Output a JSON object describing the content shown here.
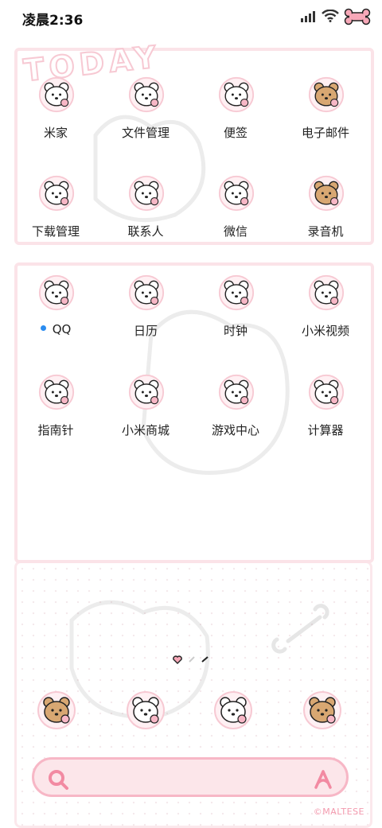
{
  "status_bar": {
    "time": "凌晨2:36",
    "icons": [
      "signal-icon",
      "wifi-icon",
      "bone-battery-icon"
    ]
  },
  "wallpaper": {
    "banner_text": "TODAY",
    "accent": "#f7b7c6",
    "frame": "#fbe3e8"
  },
  "apps": [
    {
      "label": "米家",
      "icon": "bear-mijia-icon",
      "badge": false
    },
    {
      "label": "文件管理",
      "icon": "bear-files-icon",
      "badge": false
    },
    {
      "label": "便签",
      "icon": "bear-notes-icon",
      "badge": false
    },
    {
      "label": "电子邮件",
      "icon": "bear-mail-icon",
      "badge": false
    },
    {
      "label": "下载管理",
      "icon": "bear-download-icon",
      "badge": false
    },
    {
      "label": "联系人",
      "icon": "bear-contacts-icon",
      "badge": false
    },
    {
      "label": "微信",
      "icon": "bear-wechat-icon",
      "badge": false
    },
    {
      "label": "录音机",
      "icon": "bear-recorder-icon",
      "badge": false
    },
    {
      "label": "QQ",
      "icon": "bear-qq-icon",
      "badge": true
    },
    {
      "label": "日历",
      "icon": "bear-calendar-icon",
      "badge": false
    },
    {
      "label": "时钟",
      "icon": "bear-clock-icon",
      "badge": false
    },
    {
      "label": "小米视频",
      "icon": "bear-video-icon",
      "badge": false
    },
    {
      "label": "指南针",
      "icon": "bear-compass-icon",
      "badge": false
    },
    {
      "label": "小米商城",
      "icon": "bear-mall-icon",
      "badge": false
    },
    {
      "label": "游戏中心",
      "icon": "bear-game-icon",
      "badge": false
    },
    {
      "label": "计算器",
      "icon": "bear-calculator-icon",
      "badge": false
    }
  ],
  "dock": [
    {
      "icon": "bear-phone-icon"
    },
    {
      "icon": "bear-messages-icon"
    },
    {
      "icon": "bear-camera-icon"
    },
    {
      "icon": "bear-browser-icon"
    }
  ],
  "search": {
    "left_icon": "search-icon",
    "right_icon": "assistant-icon"
  },
  "copyright": "©MALTESE",
  "colors": {
    "bear_white": "#ffffff",
    "bear_tan": "#d8a772",
    "outline": "#222222",
    "pink": "#f7b7c6",
    "badge_blue": "#2a8cf0"
  }
}
